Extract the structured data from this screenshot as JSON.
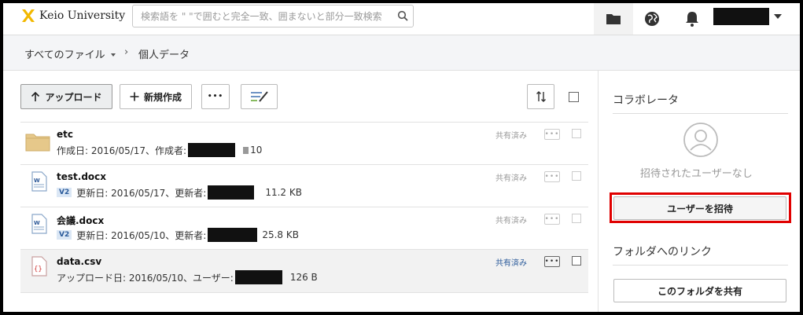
{
  "header": {
    "brand": "Keio University",
    "search_placeholder": "検索語を \" \"で囲むと完全一致、囲まないと部分一致検索",
    "icons": [
      "folder-icon",
      "globe-icon",
      "bell-icon",
      "search-icon"
    ]
  },
  "breadcrumb": {
    "root": "すべてのファイル",
    "current": "個人データ"
  },
  "toolbar": {
    "upload_label": "アップロード",
    "new_label": "新規作成",
    "more_label": "•••"
  },
  "files": [
    {
      "name": "etc",
      "type": "folder",
      "meta_prefix": "作成日: 2016/05/17、作成者:",
      "count": "10",
      "shared": "共有済み"
    },
    {
      "name": "test.docx",
      "type": "docx",
      "version": "V2",
      "meta_prefix": "更新日: 2016/05/17、更新者:",
      "size": "11.2 KB",
      "shared": "共有済み"
    },
    {
      "name": "会議.docx",
      "type": "docx",
      "version": "V2",
      "meta_prefix": "更新日: 2016/05/10、更新者:",
      "size": "25.8 KB",
      "shared": "共有済み"
    },
    {
      "name": "data.csv",
      "type": "csv",
      "meta_prefix": "アップロード日: 2016/05/10、ユーザー:",
      "size": "126 B",
      "shared": "共有済み"
    }
  ],
  "row_more_label": "•••",
  "panel": {
    "collaborators_title": "コラボレータ",
    "no_users": "招待されたユーザーなし",
    "invite_label": "ユーザーを招待",
    "link_title": "フォルダへのリンク",
    "share_label": "このフォルダを共有"
  },
  "colors": {
    "highlight_border": "#e00000",
    "shared_link": "#2a5a9a",
    "logo_gold": "#f2b800"
  }
}
